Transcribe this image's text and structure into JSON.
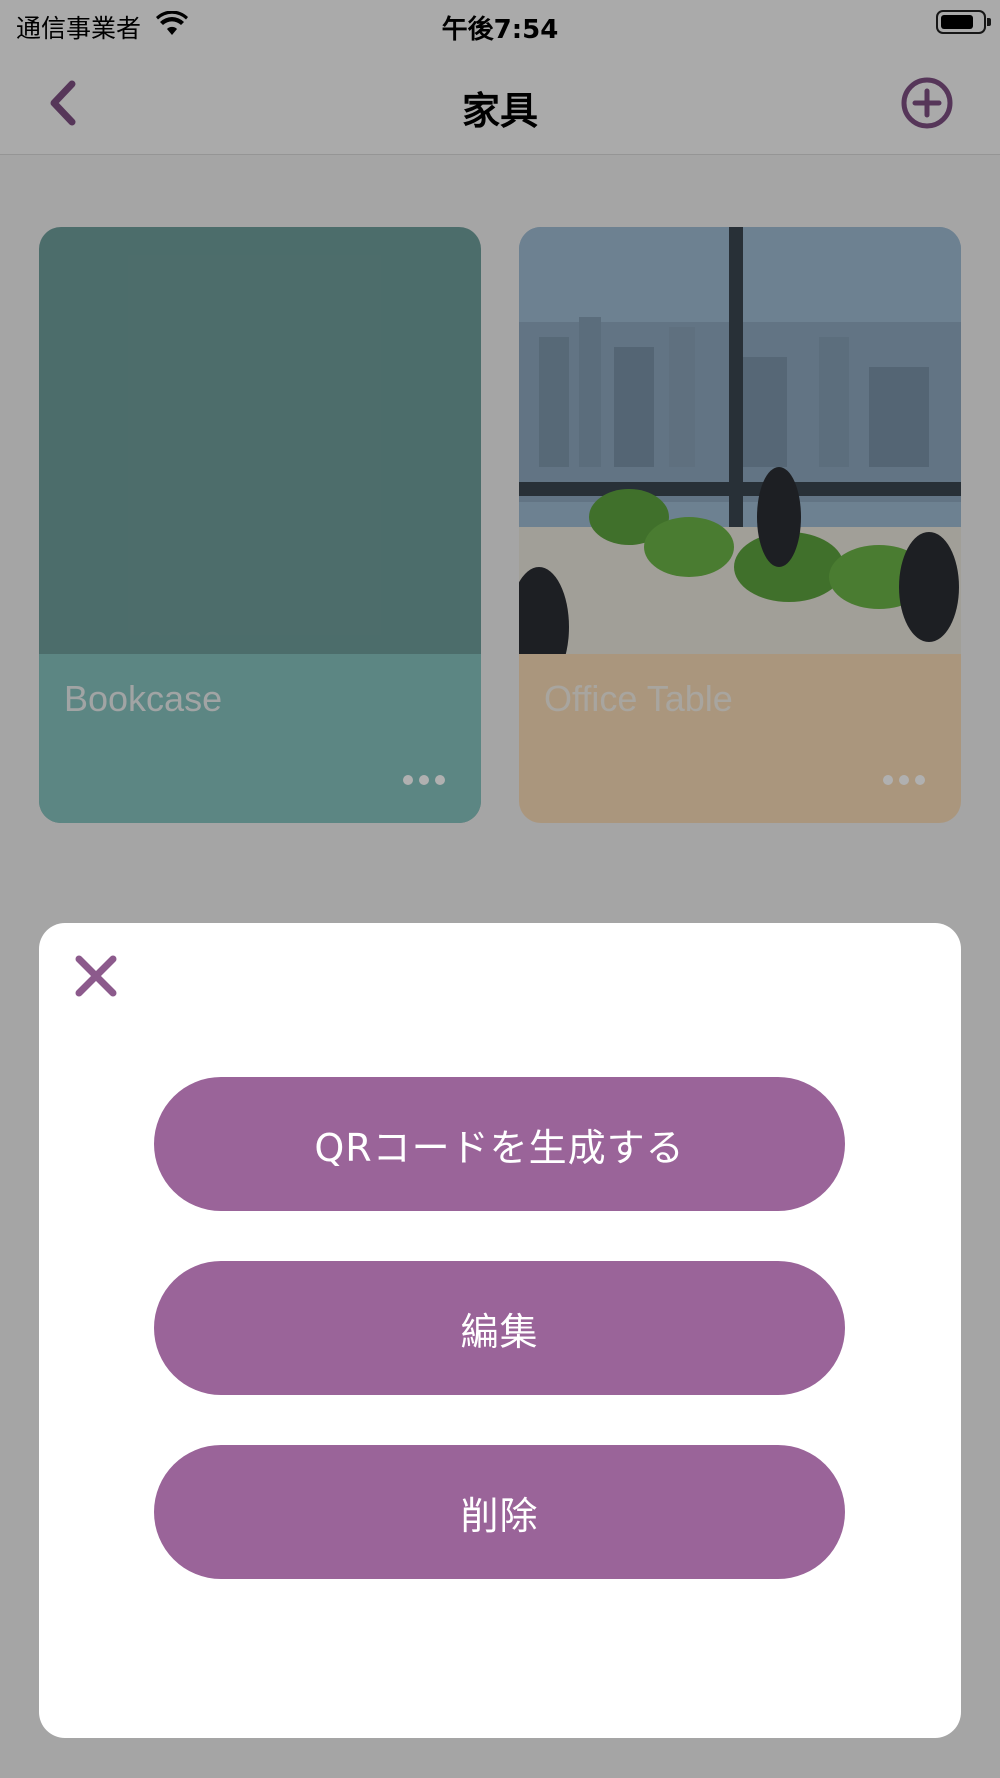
{
  "status_bar": {
    "carrier": "通信事業者",
    "time": "午後7:54"
  },
  "nav": {
    "title": "家具",
    "back_icon": "chevron-left-icon",
    "add_icon": "plus-circle-icon"
  },
  "cards": [
    {
      "label": "Bookcase",
      "more_icon": "ellipsis-icon"
    },
    {
      "label": "Office Table",
      "more_icon": "ellipsis-icon"
    }
  ],
  "sheet": {
    "close_icon": "close-icon",
    "buttons": {
      "qr": "QRコードを生成する",
      "edit": "編集",
      "delete": "削除"
    }
  },
  "colors": {
    "accent": "#9a6499",
    "icon": "#7d4f82"
  }
}
